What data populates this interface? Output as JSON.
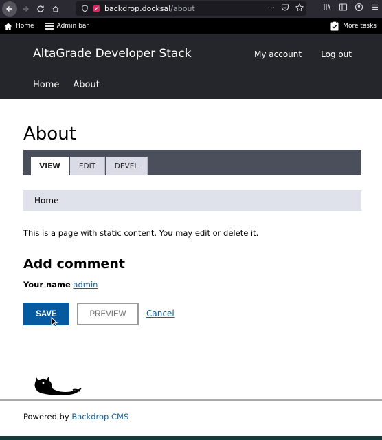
{
  "browser": {
    "url_host": "backdrop.docksal",
    "url_path": "/about",
    "toolbar_more": "···"
  },
  "admin_bar": {
    "home_label": "Home",
    "admin_bar_label": "Admin bar",
    "more_tasks_label": "More tasks"
  },
  "header": {
    "site_name": "AltaGrade Developer Stack",
    "account_links": [
      "My account",
      "Log out"
    ],
    "nav": [
      "Home",
      "About"
    ]
  },
  "page": {
    "title": "About",
    "tabs": [
      "VIEW",
      "EDIT",
      "DEVEL"
    ],
    "breadcrumb": "Home",
    "body": "This is a page with static content. You may edit or delete it."
  },
  "comment": {
    "title": "Add comment",
    "name_label": "Your name",
    "name_value": "admin",
    "save_label": "SAVE",
    "preview_label": "PREVIEW",
    "cancel_label": "Cancel"
  },
  "footer": {
    "powered_prefix": "Powered by",
    "powered_link": "Backdrop CMS"
  },
  "colors": {
    "header_bg": "#25262c",
    "tabs_bg": "#4b4f5c",
    "primary": "#065aa0",
    "link": "#0f65a5"
  },
  "icons": [
    "back-icon",
    "forward-icon",
    "reload-icon",
    "home-icon",
    "shield-icon",
    "site-icon",
    "more-icon",
    "pocket-icon",
    "star-icon",
    "library-icon",
    "sidebar-icon",
    "account-icon",
    "menu-icon",
    "hamburger-icon",
    "clipboard-check-icon",
    "backdrop-logo-icon"
  ]
}
